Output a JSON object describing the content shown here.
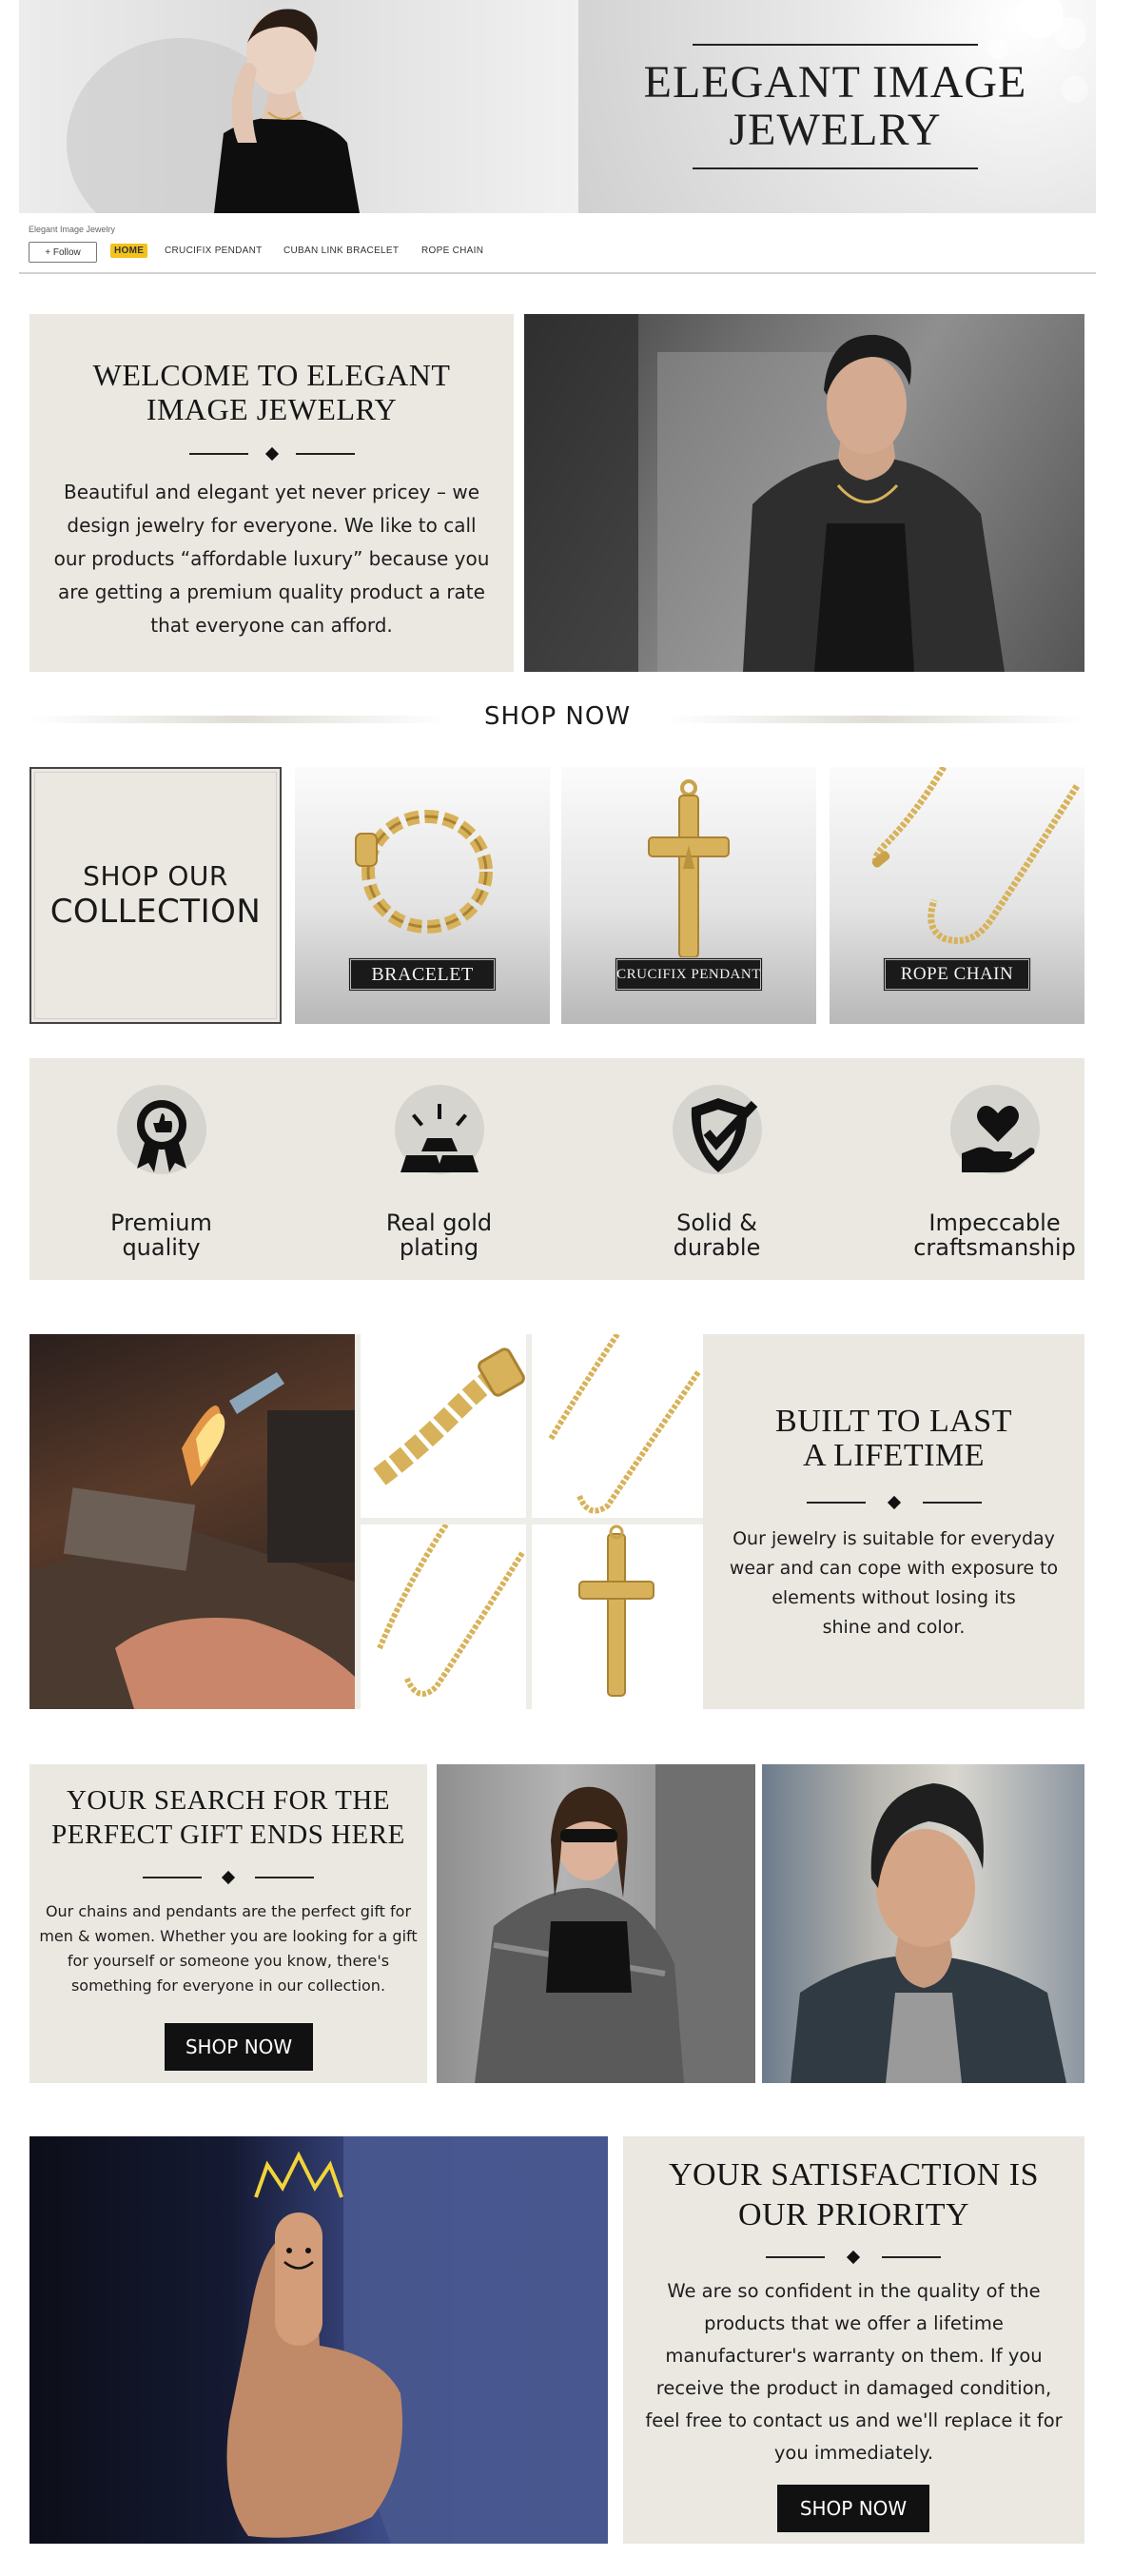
{
  "header": {
    "banner_title_line1": "ELEGANT IMAGE",
    "banner_title_line2": "JEWELRY",
    "store_name": "Elegant Image Jewelry",
    "follow_label": "+ Follow",
    "nav": [
      {
        "label": "HOME",
        "active": true
      },
      {
        "label": "CRUCIFIX PENDANT"
      },
      {
        "label": "CUBAN LINK BRACELET"
      },
      {
        "label": "ROPE CHAIN"
      }
    ],
    "active_color": "#f3c21c"
  },
  "welcome": {
    "title_line1": "WELCOME TO ELEGANT",
    "title_line2": "IMAGE JEWELRY",
    "body": "Beautiful and elegant yet never pricey – we design jewelry for everyone. We like to call our products “affordable luxury” because you are getting a premium quality product a rate that everyone can afford."
  },
  "shop_now": {
    "divider_label": "SHOP NOW"
  },
  "collection": {
    "line1": "SHOP OUR",
    "line2": "COLLECTION",
    "products": [
      {
        "label": "BRACELET",
        "icon": "bracelet-icon"
      },
      {
        "label": "CRUCIFIX PENDANT",
        "icon": "cross-pendant-icon"
      },
      {
        "label": "ROPE CHAIN",
        "icon": "rope-chain-icon"
      }
    ]
  },
  "features": [
    {
      "line1": "Premium",
      "line2": "quality",
      "icon": "award-badge-icon"
    },
    {
      "line1": "Real gold",
      "line2": "plating",
      "icon": "gold-bars-icon"
    },
    {
      "line1": "Solid &",
      "line2": "durable",
      "icon": "shield-check-icon"
    },
    {
      "line1": "Impeccable",
      "line2": "craftsmanship",
      "icon": "heart-hand-icon"
    }
  ],
  "built": {
    "title_line1": "BUILT TO LAST",
    "title_line2": "A LIFETIME",
    "body_line1": "Our jewelry is suitable for everyday",
    "body_line2": "wear and can cope with exposure to",
    "body_line3": "elements without losing its",
    "body_line4": "shine and color."
  },
  "gift": {
    "title_line1": "YOUR SEARCH FOR THE",
    "title_line2": "PERFECT GIFT ENDS HERE",
    "body": "Our chains and pendants are the perfect gift for men & women. Whether you are looking for a gift for yourself or someone you know, there's something for everyone in our collection.",
    "button": "SHOP NOW"
  },
  "satisfaction": {
    "title_line1": "YOUR SATISFACTION IS",
    "title_line2": "OUR PRIORITY",
    "body": "We are so confident in the quality of the products that we offer a lifetime manufacturer's warranty on them. If you receive the product in damaged condition, feel free to contact us and we'll replace it for you immediately.",
    "button": "SHOP NOW"
  },
  "colors": {
    "panel_beige": "#ebe8e2",
    "gold": "#d8b25a",
    "dark": "#111111"
  }
}
